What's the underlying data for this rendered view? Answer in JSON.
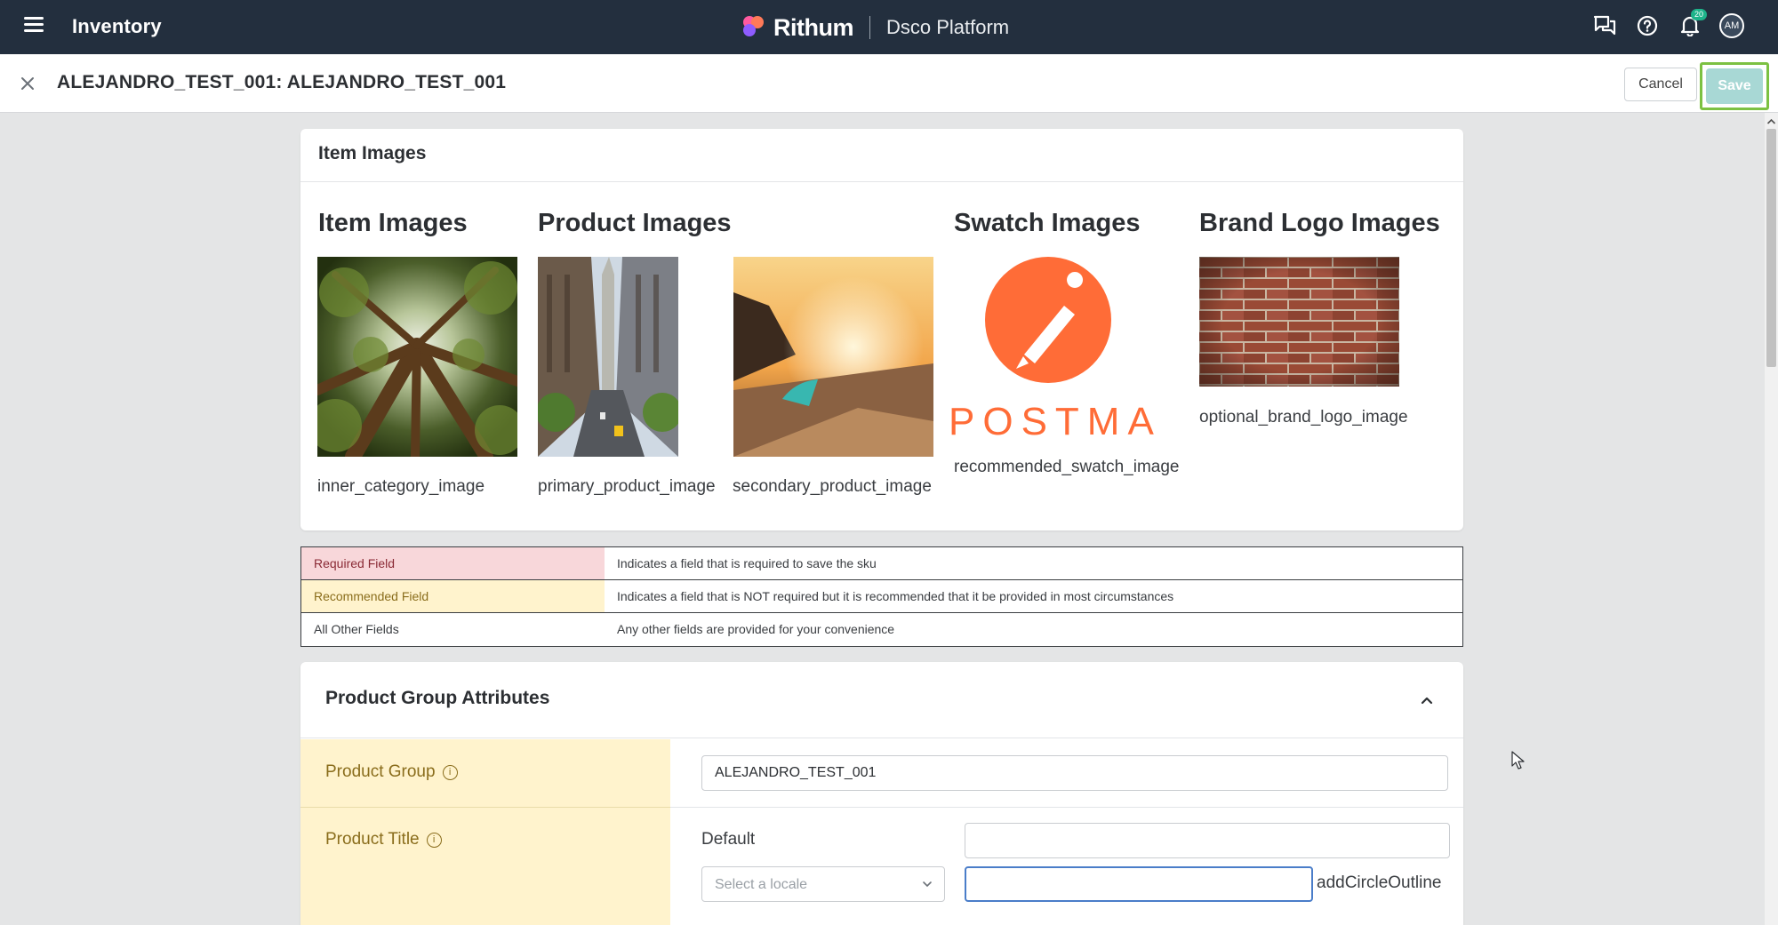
{
  "topbar": {
    "app_title": "Inventory",
    "brand_name": "Rithum",
    "brand_sub": "Dsco Platform",
    "notification_count": "20",
    "avatar_initials": "AM"
  },
  "header": {
    "title": "ALEJANDRO_TEST_001: ALEJANDRO_TEST_001",
    "cancel_label": "Cancel",
    "save_label": "Save"
  },
  "images_card": {
    "title": "Item Images",
    "groups": [
      {
        "title": "Item Images"
      },
      {
        "title": "Product Images"
      },
      {
        "title": "Swatch Images"
      },
      {
        "title": "Brand Logo Images"
      }
    ],
    "images": [
      {
        "label": "inner_category_image",
        "icon": "forest-photo"
      },
      {
        "label": "primary_product_image",
        "icon": "city-street-photo"
      },
      {
        "label": "secondary_product_image",
        "icon": "beach-surfboard-photo"
      },
      {
        "label": "recommended_swatch_image",
        "icon": "postman-logo"
      },
      {
        "label": "optional_brand_logo_image",
        "icon": "brick-wall-photo"
      }
    ],
    "postman_text": "POSTMAN"
  },
  "legend": [
    {
      "key": "Required Field",
      "desc": "Indicates a field that is required to save the sku",
      "bg": "#f8d7da",
      "color": "#8a2a35"
    },
    {
      "key": "Recommended Field",
      "desc": "Indicates a field that is NOT required but it is recommended that it be provided in most circumstances",
      "bg": "#fff3cd",
      "color": "#8a6d1c"
    },
    {
      "key": "All Other Fields",
      "desc": "Any other fields are provided for your convenience",
      "bg": "#ffffff",
      "color": "#3a3d41"
    }
  ],
  "product_group": {
    "title": "Product Group Attributes",
    "fields": {
      "product_group": {
        "label": "Product Group",
        "value": "ALEJANDRO_TEST_001"
      },
      "product_title": {
        "label": "Product Title",
        "default_label": "Default",
        "default_value": "",
        "locale_placeholder": "Select a locale",
        "locale_value": "",
        "add_label": "addCircleOutline"
      }
    }
  },
  "colors": {
    "topbar_bg": "#232f3e",
    "save_button_bg": "#a8d8d5",
    "save_focus_ring": "#7cc142",
    "recommended_bg": "#fff3cd",
    "required_bg": "#f8d7da"
  }
}
